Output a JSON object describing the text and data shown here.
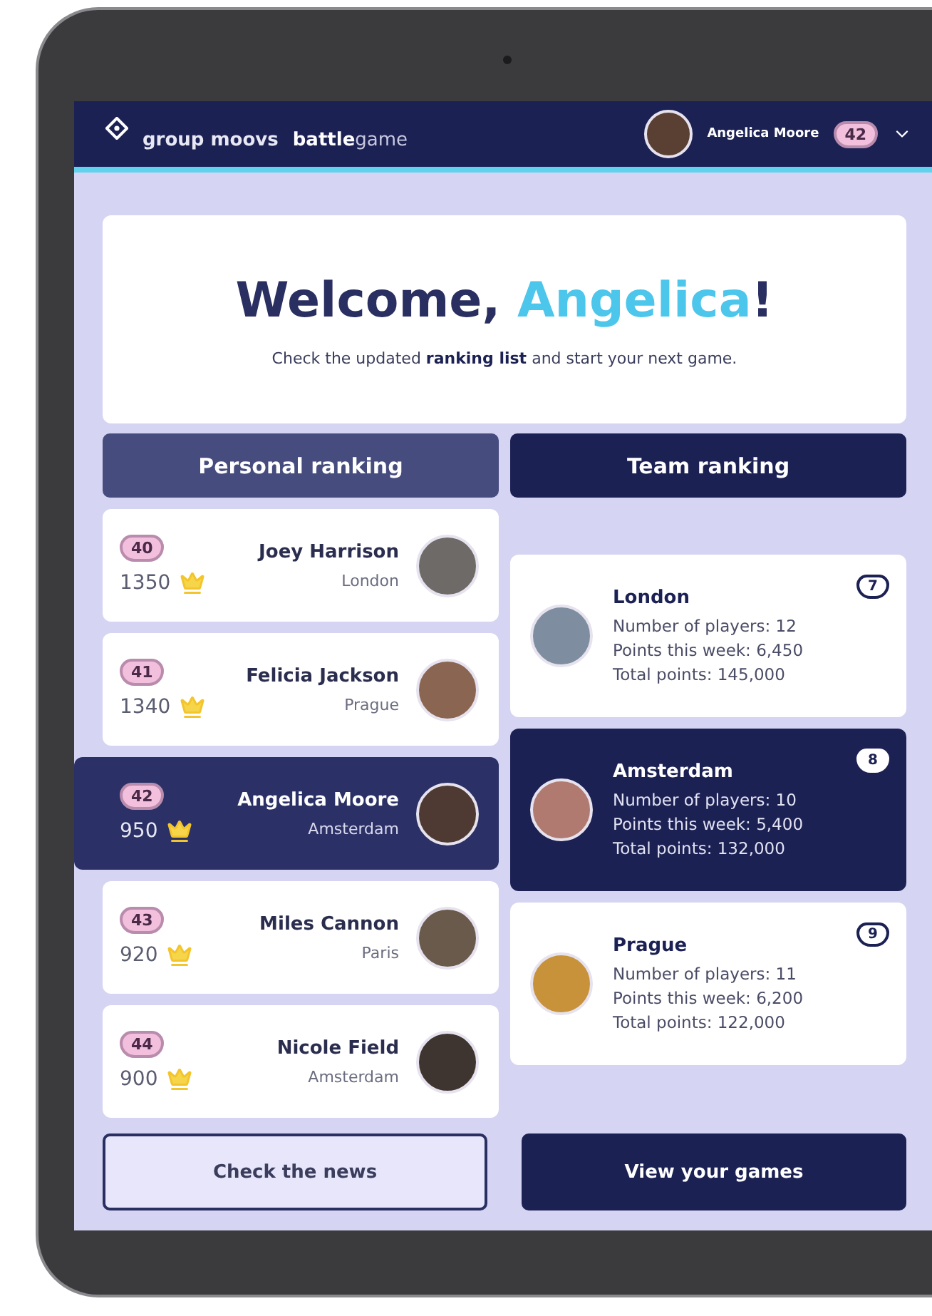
{
  "header": {
    "brand": "group moovs",
    "product": "**battle**game",
    "user_name": "Angelica Moore",
    "user_rank": "42"
  },
  "welcome": {
    "greeting": "Welcome, ",
    "name": "Angelica",
    "punctuation": "!",
    "subtitle": "Check the updated **ranking list** and start your next game."
  },
  "tabs": [
    {
      "label": "Personal ranking",
      "selected": true
    },
    {
      "label": "Team ranking",
      "selected": false
    }
  ],
  "personal_ranking": [
    {
      "rank": "40",
      "score": "1350",
      "name": "Joey Harrison",
      "city": "London",
      "selected": false
    },
    {
      "rank": "41",
      "score": "1340",
      "name": "Felicia Jackson",
      "city": "Prague",
      "selected": false
    },
    {
      "rank": "42",
      "score": "950",
      "name": "Angelica Moore",
      "city": "Amsterdam",
      "selected": true
    },
    {
      "rank": "43",
      "score": "920",
      "name": "Miles Cannon",
      "city": "Paris",
      "selected": false
    },
    {
      "rank": "44",
      "score": "900",
      "name": "Nicole Field",
      "city": "Amsterdam",
      "selected": false
    }
  ],
  "team_ranking": [
    {
      "city": "London",
      "rank": "7",
      "players": "Number of players: 12",
      "week_points": "Points this week: 6,450",
      "total_points": "Total points: 145,000",
      "selected": false
    },
    {
      "city": "Amsterdam",
      "rank": "8",
      "players": "Number of players: 10",
      "week_points": "Points this week: 5,400",
      "total_points": "Total points: 132,000",
      "selected": true
    },
    {
      "city": "Prague",
      "rank": "9",
      "players": "Number of players: 11",
      "week_points": "Points this week: 6,200",
      "total_points": "Total points: 122,000",
      "selected": false
    }
  ],
  "buttons": [
    {
      "label": "Check the news",
      "kind": "secondary"
    },
    {
      "label": "View your games",
      "kind": "primary"
    }
  ]
}
